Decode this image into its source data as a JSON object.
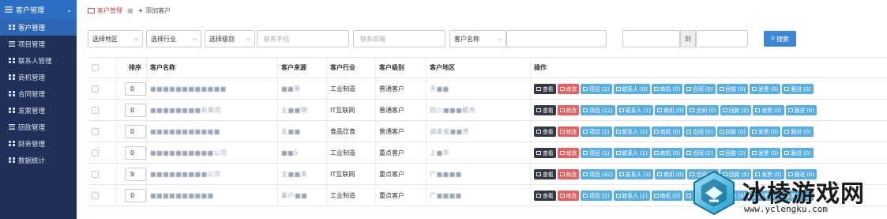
{
  "sidebar": {
    "header": "客户管理",
    "items": [
      {
        "label": "客户管理"
      },
      {
        "label": "项目管理"
      },
      {
        "label": "联系人管理"
      },
      {
        "label": "商机管理"
      },
      {
        "label": "合同管理"
      },
      {
        "label": "发票管理"
      },
      {
        "label": "回款管理"
      },
      {
        "label": "财务管理"
      },
      {
        "label": "数据统计"
      }
    ]
  },
  "breadcrumb": {
    "current": "客户管理",
    "add": "添加客户"
  },
  "filters": {
    "region": "选择地区",
    "industry": "选择行业",
    "level": "选择级别",
    "phone_placeholder": "联系手机",
    "email_placeholder": "联系邮箱",
    "name_select": "客户名称",
    "range_to": "到",
    "search": "搜索"
  },
  "table": {
    "headers": [
      "排序",
      "客户名称",
      "客户来源",
      "客户行业",
      "客户级别",
      "客户地区",
      "操作"
    ],
    "rows": [
      {
        "sort": "0",
        "name": "■■■■■■■■■■■■",
        "source": "■■来",
        "industry": "工业制造",
        "level": "普通客户",
        "region": "天■■",
        "actions": [
          "查看",
          "修改",
          "项目 (2)",
          "联系人 (0)",
          "商机 (0)",
          "合同 (0)",
          "回款 (0)",
          "发票 (0)",
          "跟进 (0)"
        ]
      },
      {
        "sort": "0",
        "name": "■■■■■■■■有限司",
        "source": "主■■销",
        "industry": "IT互联网",
        "level": "普通客户",
        "region": "四川■■■都市",
        "actions": [
          "查看",
          "修改",
          "项目 (11)",
          "联系人 (1)",
          "商机 (0)",
          "合同 (0)",
          "回款 (0)",
          "发票 (0)",
          "跟进 (0)"
        ]
      },
      {
        "sort": "0",
        "name": "■■■■■■■■■■■",
        "source": "主■■",
        "industry": "食品饮食",
        "level": "普通客户",
        "region": "湖南省■■市",
        "actions": [
          "查看",
          "修改",
          "项目 (1)",
          "联系人 (1)",
          "商机 (0)",
          "合同 (0)",
          "回款 (0)",
          "发票 (0)",
          "跟进 (0)"
        ]
      },
      {
        "sort": "0",
        "name": "■■■■■■■■■■公司",
        "source": "■■S",
        "industry": "工业制造",
        "level": "重点客户",
        "region": "上■市",
        "actions": [
          "查看",
          "修改",
          "项目 (1)",
          "联系人 (1)",
          "商机 (0)",
          "合同 (2)",
          "回款 (2)",
          "发票 (0)",
          "跟进 (0)"
        ]
      },
      {
        "sort": "9",
        "name": "■■■■■■■■■公司",
        "source": "主■■表",
        "industry": "IT互联网",
        "level": "重点客户",
        "region": "广■■■■",
        "actions": [
          "查看",
          "修改",
          "项目 (42)",
          "联系人 (3)",
          "商机 (0)",
          "合同 (0)",
          "回款 (0)",
          "发票 (0)",
          "跟进 (0)"
        ]
      },
      {
        "sort": "0",
        "name": "■■■■■■■■■■",
        "source": "客户■■",
        "industry": "工业制造",
        "level": "重点客户",
        "region": "广■■■■",
        "actions": [
          "查看",
          "修改",
          "项目 (2)",
          "联系人 (1)",
          "商机 (0)",
          "合同 (0)",
          "回款 (0)",
          "发票 (0)",
          "跟进 (0)"
        ]
      }
    ]
  },
  "watermark": {
    "title": "冰棱游戏网",
    "url": "www.yclengku.com"
  },
  "colors": {
    "sidebar_bg": "#1f3158",
    "sidebar_active": "#2e66b5",
    "btn_view": "#333a44",
    "btn_edit": "#e06262",
    "btn_info": "#5aaee0",
    "search": "#3b86d8"
  }
}
